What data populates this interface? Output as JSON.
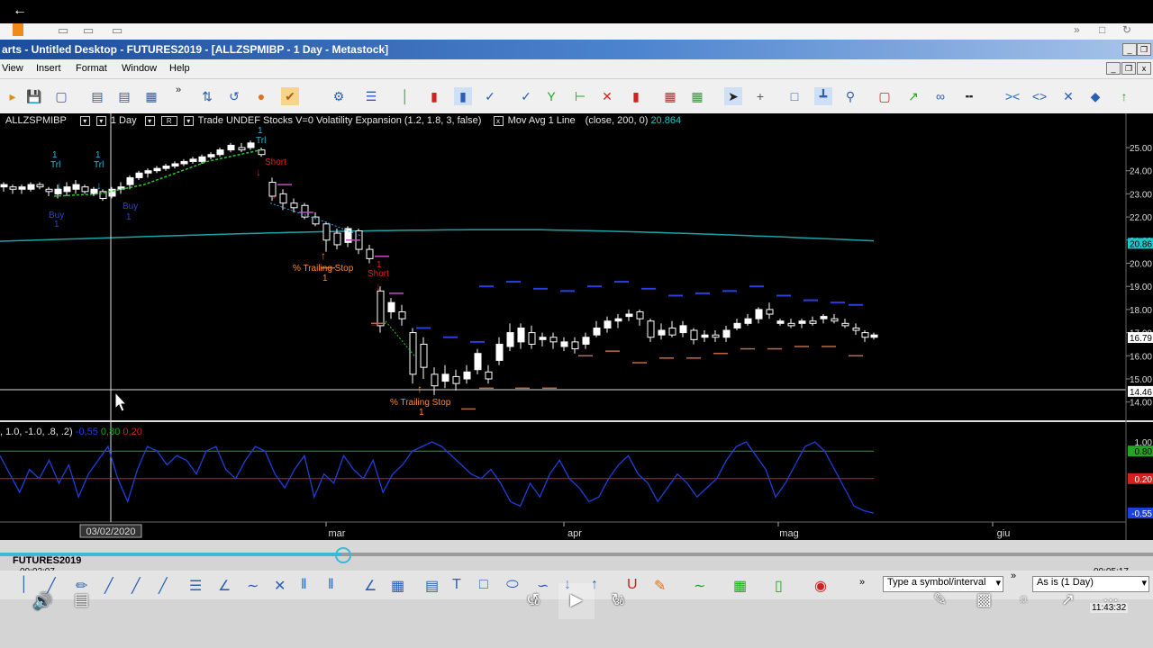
{
  "window": {
    "title": "arts - Untitled Desktop - FUTURES2019 - [ALLZSPMIBP - 1 Day - Metastock]"
  },
  "menu": [
    "View",
    "Insert",
    "Format",
    "Window",
    "Help"
  ],
  "chart_header": {
    "symbol": "ALLZSPMIBP",
    "interval": "1 Day",
    "trade_label": "Trade",
    "trade_mode": "UNDEF",
    "security_type": "Stocks",
    "version": "V=0",
    "expert_text": "Volatility Expansion (1.2, 1.8, 3, false)",
    "ma_label": "Mov Avg 1 Line",
    "ma_params": "(close, 200, 0)",
    "ma_value": "20.864"
  },
  "indicator_header": {
    "params": ", 1.0, -1.0, .8, .2)",
    "value_blue": "-0,55",
    "value_green": "0,80",
    "value_red": "0,20"
  },
  "price_axis": [
    "25.00",
    "24.00",
    "23.00",
    "22.00",
    "21.00",
    "20.00",
    "19.00",
    "18.00",
    "17.00",
    "16.00",
    "15.00",
    "14.00"
  ],
  "price_tags": {
    "ma": "20.86",
    "last": "16.79",
    "level": "14.46"
  },
  "indicator_axis": {
    "top": "1.00",
    "green": "0.80",
    "red": "0.20",
    "bottom": "-0.55"
  },
  "date_axis": {
    "cursor_date": "03/02/2020",
    "months": [
      "mar",
      "apr",
      "mag",
      "giu"
    ]
  },
  "annotations": {
    "trl": "Trl",
    "one": "1",
    "buy": "Buy",
    "short": "Short",
    "trailing_stop": "% Trailing Stop"
  },
  "chart_data": {
    "type": "candlestick",
    "ma_value": 20.864,
    "indicator_levels": {
      "upper": 0.8,
      "lower": 0.2
    },
    "ylim": [
      13.5,
      25.5
    ]
  },
  "player": {
    "tab_label": "FUTURES2019",
    "time_elapsed": "00:02:07",
    "time_total": "00:05:17",
    "symbol_placeholder": "Type a symbol/interval",
    "interval_select": "As is (1 Day)",
    "rewind_label": "10",
    "forward_label": "30",
    "clock": "11:43:32",
    "progress": 0.296
  },
  "colors": {
    "title_gradient_start": "#1c4c9c",
    "ma_line": "#1aa6a6",
    "indicator": "#1e3fd8",
    "green_level": "#1fa81f",
    "red_level": "#d42020",
    "progress": "#3bb9d6"
  }
}
